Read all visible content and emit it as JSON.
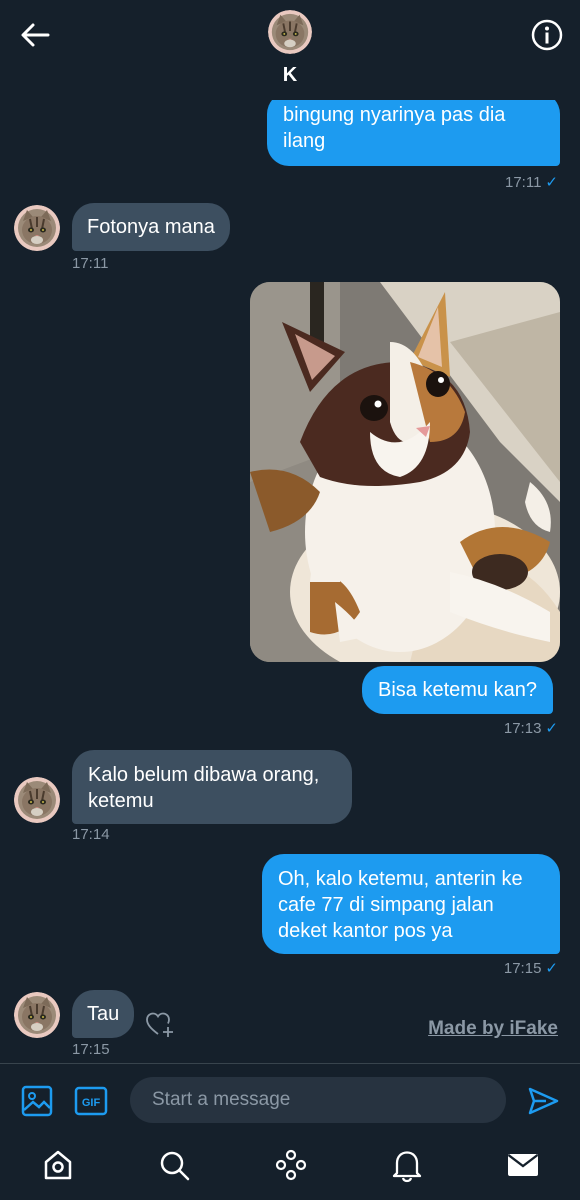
{
  "header": {
    "contact_name": "K",
    "back_icon": "arrow-left-icon",
    "info_icon": "info-icon"
  },
  "messages": [
    {
      "direction": "out",
      "lines": [
        "bingung nyarinya pas dia",
        "ilang"
      ],
      "time": "17:11",
      "read": "✓"
    },
    {
      "direction": "in",
      "text": "Fotonya mana",
      "time": "17:11"
    },
    {
      "direction": "out",
      "type": "image",
      "image": "calico-cat-photo"
    },
    {
      "direction": "out",
      "text": "Bisa ketemu kan?",
      "time": "17:13",
      "read": "✓"
    },
    {
      "direction": "in",
      "lines": [
        "Kalo belum dibawa orang,",
        "ketemu"
      ],
      "time": "17:14"
    },
    {
      "direction": "out",
      "lines": [
        "Oh, kalo ketemu, anterin ke",
        "cafe 77 di simpang jalan",
        "deket kantor pos ya"
      ],
      "time": "17:15",
      "read": "✓"
    },
    {
      "direction": "in",
      "text": "Tau",
      "time": "17:15"
    }
  ],
  "watermark": "Made by iFake",
  "composer": {
    "placeholder": "Start a message",
    "gif_label": "GIF"
  },
  "tabs": [
    "home-icon",
    "search-icon",
    "spaces-icon",
    "bell-icon",
    "mail-icon"
  ],
  "colors": {
    "background": "#15202b",
    "outgoing_bubble": "#1d9bf0",
    "incoming_bubble": "#3d4f60",
    "muted_text": "#8b98a5"
  }
}
